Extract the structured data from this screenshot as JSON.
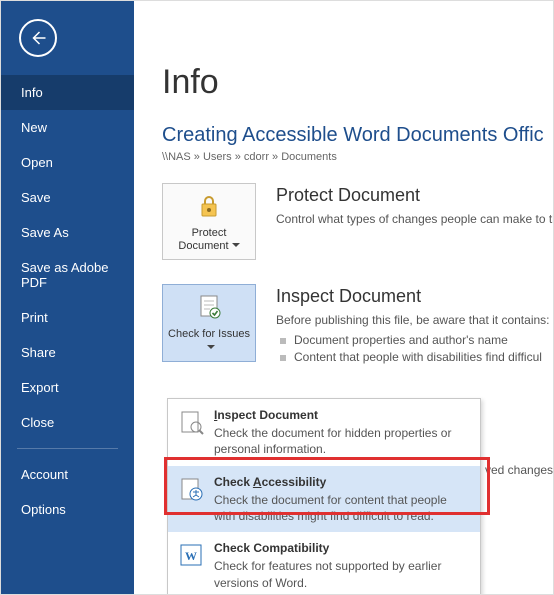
{
  "window_title": "Creating Accessible W",
  "sidebar": {
    "items": [
      {
        "label": "Info",
        "selected": true
      },
      {
        "label": "New"
      },
      {
        "label": "Open"
      },
      {
        "label": "Save"
      },
      {
        "label": "Save As"
      },
      {
        "label": "Save as Adobe PDF"
      },
      {
        "label": "Print"
      },
      {
        "label": "Share"
      },
      {
        "label": "Export"
      },
      {
        "label": "Close"
      }
    ],
    "footer": [
      {
        "label": "Account"
      },
      {
        "label": "Options"
      }
    ]
  },
  "page": {
    "heading": "Info",
    "doc_title": "Creating Accessible Word Documents Offic",
    "breadcrumb": "\\\\NAS » Users » cdorr » Documents",
    "protect": {
      "tile_label": "Protect Document",
      "title": "Protect Document",
      "desc": "Control what types of changes people can make to th"
    },
    "inspect": {
      "tile_label": "Check for Issues",
      "title": "Inspect Document",
      "desc": "Before publishing this file, be aware that it contains:",
      "bullets": [
        "Document properties and author's name",
        "Content that people with disabilities find difficul"
      ]
    },
    "trailing_text": "ved changes."
  },
  "menu": {
    "items": [
      {
        "name": "inspect-document",
        "title_pre": "",
        "title_u": "I",
        "title_post": "nspect Document",
        "desc": "Check the document for hidden properties or personal information."
      },
      {
        "name": "check-accessibility",
        "title_pre": "Check ",
        "title_u": "A",
        "title_post": "ccessibility",
        "desc": "Check the document for content that people with disabilities might find difficult to read.",
        "highlight": true
      },
      {
        "name": "check-compatibility",
        "title_pre": "Check Compatibility",
        "title_u": "",
        "title_post": "",
        "desc": "Check for features not supported by earlier versions of Word."
      }
    ]
  }
}
